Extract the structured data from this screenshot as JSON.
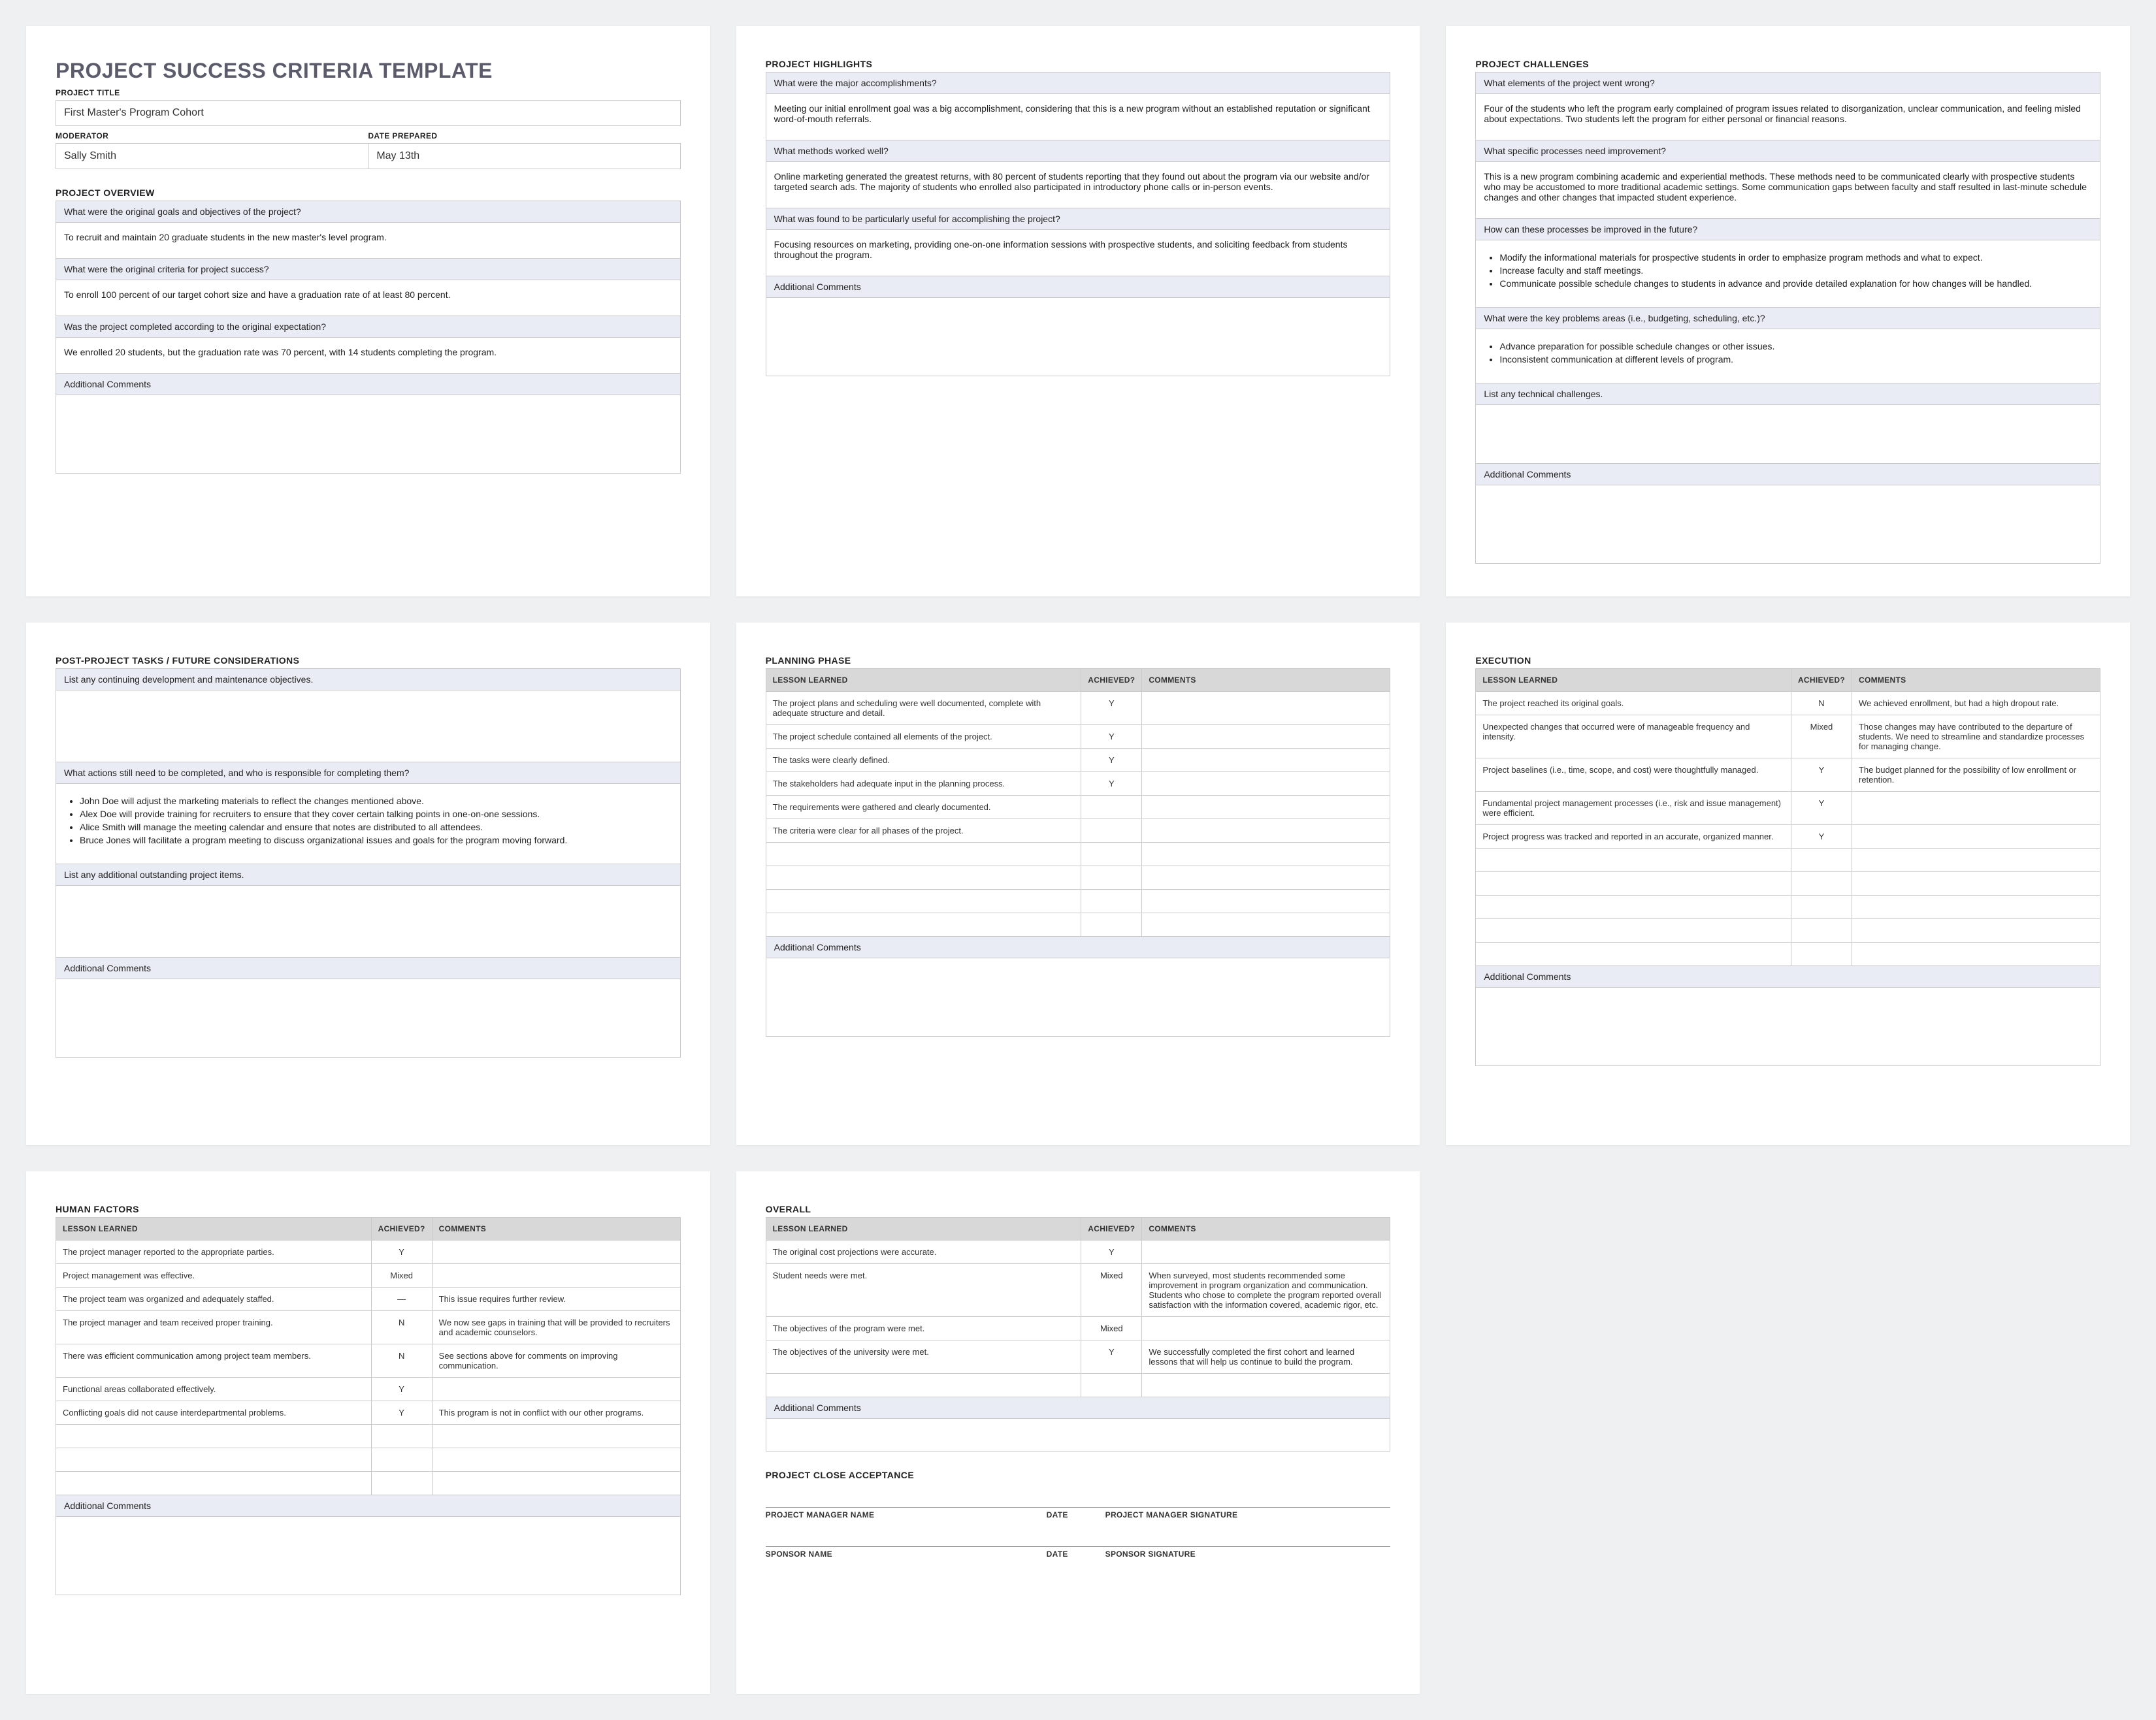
{
  "header": {
    "title": "PROJECT SUCCESS CRITERIA TEMPLATE",
    "labels": {
      "projectTitle": "PROJECT TITLE",
      "moderator": "MODERATOR",
      "datePrepared": "DATE PREPARED"
    },
    "values": {
      "projectTitle": "First Master's Program Cohort",
      "moderator": "Sally Smith",
      "datePrepared": "May 13th"
    }
  },
  "overview": {
    "heading": "PROJECT OVERVIEW",
    "q1": "What were the original goals and objectives of the project?",
    "a1": "To recruit and maintain 20 graduate students in the new master's level program.",
    "q2": "What were the original criteria for project success?",
    "a2": "To enroll 100 percent of our target cohort size and have a graduation rate of at least 80 percent.",
    "q3": "Was the project completed according to the original expectation?",
    "a3": "We enrolled 20 students, but the graduation rate was 70 percent, with 14 students completing the program.",
    "addl": "Additional Comments"
  },
  "highlights": {
    "heading": "PROJECT HIGHLIGHTS",
    "q1": "What were the major accomplishments?",
    "a1": "Meeting our initial enrollment goal was a big accomplishment, considering that this is a new program without an established reputation or significant word-of-mouth referrals.",
    "q2": "What methods worked well?",
    "a2": "Online marketing generated the greatest returns, with 80 percent of students reporting that they found out about the program via our website and/or targeted search ads. The majority of students who enrolled also participated in introductory phone calls or in-person events.",
    "q3": "What was found to be particularly useful for accomplishing the project?",
    "a3": "Focusing resources on marketing, providing one-on-one information sessions with prospective students, and soliciting feedback from students throughout the program.",
    "addl": "Additional Comments"
  },
  "challenges": {
    "heading": "PROJECT CHALLENGES",
    "q1": "What elements of the project went wrong?",
    "a1": "Four of the students who left the program early complained of program issues related to disorganization, unclear communication, and feeling misled about expectations. Two students left the program for either personal or financial reasons.",
    "q2": "What specific processes need improvement?",
    "a2": "This is a new program combining academic and experiential methods. These methods need to be communicated clearly with prospective students who may be accustomed to more traditional academic settings. Some communication gaps between faculty and staff resulted in last-minute schedule changes and other changes that impacted student experience.",
    "q3": "How can these processes be improved in the future?",
    "a3items": [
      "Modify the informational materials for prospective students in order to emphasize program methods and what to expect.",
      "Increase faculty and staff meetings.",
      "Communicate possible schedule changes to students in advance and provide detailed explanation for how changes will be handled."
    ],
    "q4": "What were the key problems areas (i.e., budgeting, scheduling, etc.)?",
    "a4items": [
      "Advance preparation for possible schedule changes or other issues.",
      "Inconsistent communication at different levels of program."
    ],
    "q5": "List any technical challenges.",
    "addl": "Additional Comments"
  },
  "postproject": {
    "heading": "POST-PROJECT TASKS / FUTURE CONSIDERATIONS",
    "q1": "List any continuing development and maintenance objectives.",
    "q2": "What actions still need to be completed, and who is responsible for completing them?",
    "a2items": [
      "John Doe will adjust the marketing materials to reflect the changes mentioned above.",
      "Alex Doe will provide training for recruiters to ensure that they cover certain talking points in one-on-one sessions.",
      "Alice Smith will manage the meeting calendar and ensure that notes are distributed to all attendees.",
      "Bruce Jones will facilitate a program meeting to discuss organizational issues and goals for the program moving forward."
    ],
    "q3": "List any additional outstanding project items.",
    "addl": "Additional Comments"
  },
  "planning": {
    "heading": "PLANNING PHASE",
    "cols": {
      "lesson": "LESSON LEARNED",
      "ach": "ACHIEVED?",
      "com": "COMMENTS"
    },
    "rows": [
      {
        "l": "The project plans and scheduling were well documented, complete with adequate structure and detail.",
        "a": "Y",
        "c": ""
      },
      {
        "l": "The project schedule contained all elements of the project.",
        "a": "Y",
        "c": ""
      },
      {
        "l": "The tasks were clearly defined.",
        "a": "Y",
        "c": ""
      },
      {
        "l": "The stakeholders had adequate input in the planning process.",
        "a": "Y",
        "c": ""
      },
      {
        "l": "The requirements were gathered and clearly documented.",
        "a": "",
        "c": ""
      },
      {
        "l": "The criteria were clear for all phases of the project.",
        "a": "",
        "c": ""
      },
      {
        "l": "",
        "a": "",
        "c": ""
      },
      {
        "l": "",
        "a": "",
        "c": ""
      },
      {
        "l": "",
        "a": "",
        "c": ""
      },
      {
        "l": "",
        "a": "",
        "c": ""
      }
    ],
    "addl": "Additional Comments"
  },
  "execution": {
    "heading": "EXECUTION",
    "rows": [
      {
        "l": "The project reached its original goals.",
        "a": "N",
        "c": "We achieved enrollment, but had a high dropout rate."
      },
      {
        "l": "Unexpected changes that occurred were of manageable frequency and intensity.",
        "a": "Mixed",
        "c": "Those changes may have contributed to the departure of students. We need to streamline and standardize processes for managing change."
      },
      {
        "l": "Project baselines (i.e., time, scope, and cost) were thoughtfully managed.",
        "a": "Y",
        "c": "The budget planned for the possibility of low enrollment or retention."
      },
      {
        "l": "Fundamental project management processes (i.e., risk and issue management) were efficient.",
        "a": "Y",
        "c": ""
      },
      {
        "l": "Project progress was tracked and reported in an accurate, organized manner.",
        "a": "Y",
        "c": ""
      },
      {
        "l": "",
        "a": "",
        "c": ""
      },
      {
        "l": "",
        "a": "",
        "c": ""
      },
      {
        "l": "",
        "a": "",
        "c": ""
      },
      {
        "l": "",
        "a": "",
        "c": ""
      },
      {
        "l": "",
        "a": "",
        "c": ""
      }
    ],
    "addl": "Additional Comments"
  },
  "human": {
    "heading": "HUMAN FACTORS",
    "rows": [
      {
        "l": "The project manager reported to the appropriate parties.",
        "a": "Y",
        "c": ""
      },
      {
        "l": "Project management was effective.",
        "a": "Mixed",
        "c": ""
      },
      {
        "l": "The project team was organized and adequately staffed.",
        "a": "—",
        "c": "This issue requires further review."
      },
      {
        "l": "The project manager and team received proper training.",
        "a": "N",
        "c": "We now see gaps in training that will be provided to recruiters and academic counselors."
      },
      {
        "l": "There was efficient communication among project team members.",
        "a": "N",
        "c": "See sections above for comments on improving communication."
      },
      {
        "l": "Functional areas collaborated effectively.",
        "a": "Y",
        "c": ""
      },
      {
        "l": "Conflicting goals did not cause interdepartmental problems.",
        "a": "Y",
        "c": "This program is not in conflict with our other programs."
      },
      {
        "l": "",
        "a": "",
        "c": ""
      },
      {
        "l": "",
        "a": "",
        "c": ""
      },
      {
        "l": "",
        "a": "",
        "c": ""
      }
    ],
    "addl": "Additional Comments"
  },
  "overall": {
    "heading": "OVERALL",
    "rows": [
      {
        "l": "The original cost projections were accurate.",
        "a": "Y",
        "c": ""
      },
      {
        "l": "Student needs were met.",
        "a": "Mixed",
        "c": "When surveyed, most students recommended some improvement in program organization and communication. Students who chose to complete the program reported overall satisfaction with the information covered, academic rigor, etc."
      },
      {
        "l": "The objectives of the program were met.",
        "a": "Mixed",
        "c": ""
      },
      {
        "l": "The objectives of the university were met.",
        "a": "Y",
        "c": "We successfully completed the first cohort and learned lessons that will help us continue to build the program."
      },
      {
        "l": "",
        "a": "",
        "c": ""
      }
    ],
    "addl": "Additional Comments",
    "close": {
      "heading": "PROJECT CLOSE ACCEPTANCE",
      "pmName": "PROJECT MANAGER NAME",
      "date": "DATE",
      "pmSig": "PROJECT MANAGER SIGNATURE",
      "spName": "SPONSOR NAME",
      "spSig": "SPONSOR SIGNATURE"
    }
  }
}
